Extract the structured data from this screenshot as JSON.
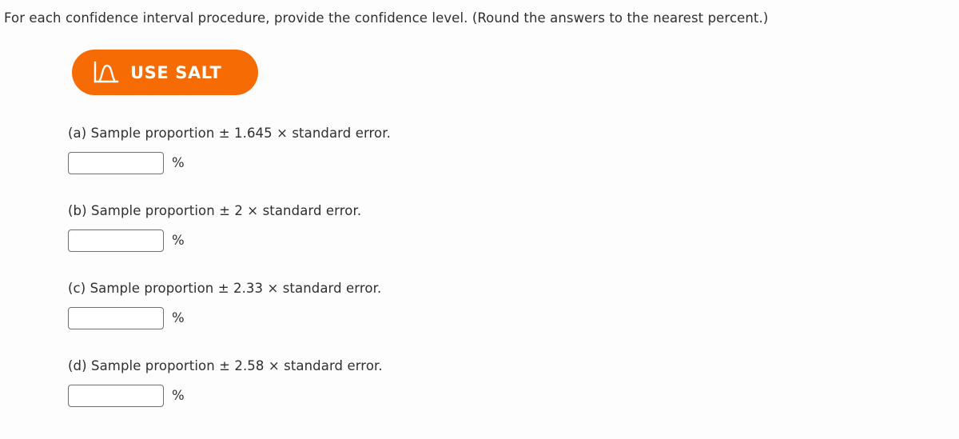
{
  "prompt": "For each confidence interval procedure, provide the confidence level. (Round the answers to the nearest percent.)",
  "salt_button": {
    "label": "USE SALT",
    "icon": "distribution-curve-icon",
    "background_color": "#f76b05",
    "text_color": "#ffffff"
  },
  "unit": "%",
  "parts": [
    {
      "id": "a",
      "text": "(a) Sample proportion ± 1.645 × standard error.",
      "multiplier": "1.645",
      "value": "",
      "placeholder": ""
    },
    {
      "id": "b",
      "text": "(b) Sample proportion ± 2 × standard error.",
      "multiplier": "2",
      "value": "",
      "placeholder": ""
    },
    {
      "id": "c",
      "text": "(c) Sample proportion ± 2.33 × standard error.",
      "multiplier": "2.33",
      "value": "",
      "placeholder": ""
    },
    {
      "id": "d",
      "text": "(d) Sample proportion ± 2.58 × standard error.",
      "multiplier": "2.58",
      "value": "",
      "placeholder": ""
    }
  ],
  "colors": {
    "page_background": "#fdfdfd",
    "text": "#2f2f2f",
    "input_border": "#6f6f6f",
    "accent_orange": "#f76b05"
  }
}
